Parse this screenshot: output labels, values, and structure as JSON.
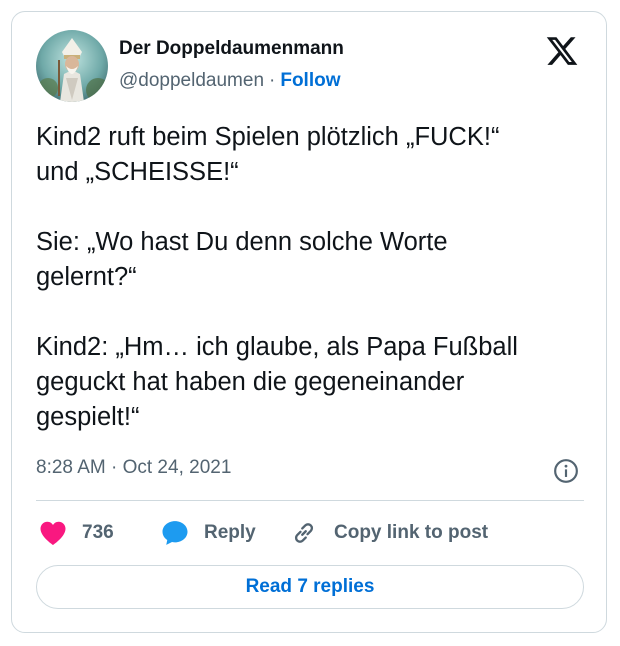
{
  "author": {
    "name": "Der Doppeldaumenmann",
    "handle": "@doppeldaumen",
    "separator": "·",
    "follow_label": "Follow"
  },
  "tweet": {
    "paragraphs": [
      [
        "Kind2 ruft beim Spielen plötzlich  „FUCK!“",
        "und „SCHEISSE!“"
      ],
      [
        "Sie: „Wo hast Du denn solche Worte",
        "gelernt?“"
      ],
      [
        "Kind2: „Hm… ich glaube, als Papa Fußball",
        "geguckt hat haben die gegeneinander",
        "gespielt!“"
      ]
    ],
    "timestamp": "8:28 AM · Oct 24, 2021"
  },
  "actions": {
    "like_count": "736",
    "reply_label": "Reply",
    "copy_link_label": "Copy link to post"
  },
  "read_replies_label": "Read 7 replies",
  "icons": {
    "brand": "x-logo-icon",
    "like": "heart-icon",
    "reply": "speech-bubble-icon",
    "copy": "link-icon",
    "info": "info-icon"
  },
  "colors": {
    "text": "#0f1419",
    "secondary": "#536471",
    "link": "#006fd6",
    "like": "#f91880",
    "reply": "#1d9bf0",
    "border": "#cfd9de"
  }
}
